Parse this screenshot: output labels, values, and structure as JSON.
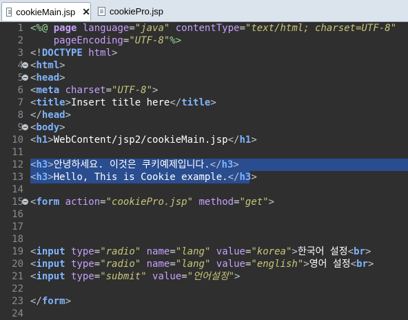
{
  "tabs": [
    {
      "label": "cookieMain.jsp",
      "active": true,
      "closable": true
    },
    {
      "label": "cookiePro.jsp",
      "active": false,
      "closable": false
    }
  ],
  "editor": {
    "lines": [
      {
        "n": "1",
        "fold": false
      },
      {
        "n": "2",
        "fold": false
      },
      {
        "n": "3",
        "fold": false
      },
      {
        "n": "4",
        "fold": true
      },
      {
        "n": "5",
        "fold": true
      },
      {
        "n": "6",
        "fold": false
      },
      {
        "n": "7",
        "fold": false
      },
      {
        "n": "8",
        "fold": false
      },
      {
        "n": "9",
        "fold": true
      },
      {
        "n": "10",
        "fold": false
      },
      {
        "n": "11",
        "fold": false
      },
      {
        "n": "12",
        "fold": false
      },
      {
        "n": "13",
        "fold": false
      },
      {
        "n": "14",
        "fold": false
      },
      {
        "n": "15",
        "fold": true
      },
      {
        "n": "16",
        "fold": false
      },
      {
        "n": "17",
        "fold": false
      },
      {
        "n": "18",
        "fold": false
      },
      {
        "n": "19",
        "fold": false
      },
      {
        "n": "20",
        "fold": false
      },
      {
        "n": "21",
        "fold": false
      },
      {
        "n": "22",
        "fold": false
      },
      {
        "n": "23",
        "fold": false
      },
      {
        "n": "24",
        "fold": false
      }
    ],
    "tokens": {
      "l1_open": "<%@",
      "l1_page": " page",
      "l1_lang_attr": " language",
      "l1_eq1": "=",
      "l1_lang_val": "\"java\"",
      "l1_ct_attr": " contentType",
      "l1_eq2": "=",
      "l1_ct_val": "\"text/html; charset=UTF-8\"",
      "l2_indent": "    ",
      "l2_pe_attr": "pageEncoding",
      "l2_eq": "=",
      "l2_pe_val": "\"UTF-8\"",
      "l2_close": "%>",
      "l3_doctype_open": "<!",
      "l3_doctype": "DOCTYPE",
      "l3_html": " html",
      "l3_close": ">",
      "l4": "html",
      "l5": "head",
      "l6_tag": "meta",
      "l6_attr": " charset",
      "l6_eq": "=",
      "l6_val": "\"UTF-8\"",
      "l7_tag": "title",
      "l7_text": "Insert title here",
      "l8_tag": "head",
      "l9_tag": "body",
      "l10_tag": "h1",
      "l10_text": "WebContent/jsp2/cookieMain.jsp",
      "l12_tag": "h3",
      "l12_text": "안녕하세요. 이것은 쿠키예제입니다.",
      "l13_tag": "h3",
      "l13_text": "Hello, This is Cookie example.",
      "l15_tag": "form",
      "l15_action_attr": " action",
      "l15_action_val": "\"cookiePro.jsp\"",
      "l15_method_attr": " method",
      "l15_method_val": "\"get\"",
      "l19_tag": "input",
      "l19_type_attr": " type",
      "l19_type_val": "\"radio\"",
      "l19_name_attr": " name",
      "l19_name_val": "\"lang\"",
      "l19_value_attr": " value",
      "l19_value_val": "\"korea\"",
      "l19_text": "한국어 설정",
      "l19_br": "br",
      "l20_tag": "input",
      "l20_type_attr": " type",
      "l20_type_val": "\"radio\"",
      "l20_name_attr": " name",
      "l20_name_val": "\"lang\"",
      "l20_value_attr": " value",
      "l20_value_val": "\"english\"",
      "l20_text": "영어 설정",
      "l20_br": "br",
      "l21_tag": "input",
      "l21_type_attr": " type",
      "l21_type_val": "\"submit\"",
      "l21_value_attr": " value",
      "l21_value_val": "\"언어설정\"",
      "l23_tag": "form"
    }
  },
  "colors": {
    "background": "#2f2f2f",
    "selection": "#2a4d8f",
    "tag": "#7fb4ff",
    "attribute": "#c6a0ff",
    "value": "#c7c77a",
    "line_number": "#8b8b8b"
  }
}
